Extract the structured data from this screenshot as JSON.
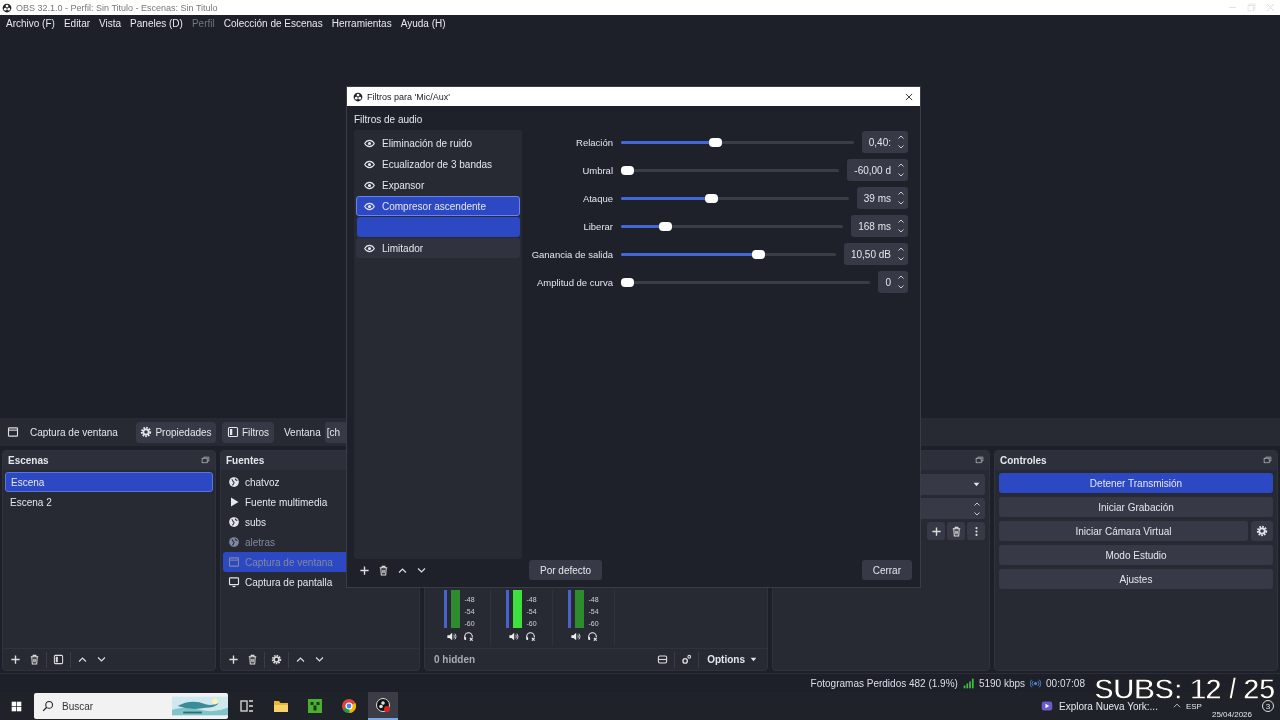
{
  "window": {
    "title": "OBS 32.1.0 - Perfil: Sin Titulo - Escenas: Sin Titulo"
  },
  "menu": [
    {
      "label": "Archivo (F)",
      "disabled": false
    },
    {
      "label": "Editar",
      "disabled": false
    },
    {
      "label": "Vista",
      "disabled": false
    },
    {
      "label": "Paneles (D)",
      "disabled": false
    },
    {
      "label": "Perfil",
      "disabled": true
    },
    {
      "label": "Colección de Escenas",
      "disabled": false
    },
    {
      "label": "Herramientas",
      "disabled": false
    },
    {
      "label": "Ayuda (H)",
      "disabled": false
    }
  ],
  "source_toolbar": {
    "source": "Captura de ventana",
    "buttons": [
      {
        "label": "Propiedades"
      },
      {
        "label": "Filtros"
      }
    ],
    "field_label": "Ventana",
    "field_value": "[ch"
  },
  "scenes": {
    "title": "Escenas",
    "items": [
      {
        "label": "Escena",
        "selected": true
      },
      {
        "label": "Escena 2",
        "selected": false
      }
    ]
  },
  "sources": {
    "title": "Fuentes",
    "items": [
      {
        "label": "chatvoz",
        "kind": "browser",
        "selected": false,
        "hidden": false
      },
      {
        "label": "Fuente multimedia",
        "kind": "media",
        "selected": false,
        "hidden": false
      },
      {
        "label": "subs",
        "kind": "browser",
        "selected": false,
        "hidden": false
      },
      {
        "label": "aletras",
        "kind": "browser",
        "selected": false,
        "hidden": true
      },
      {
        "label": "Captura de ventana",
        "kind": "window",
        "selected": true,
        "hidden": true
      },
      {
        "label": "Captura de pantalla",
        "kind": "display",
        "selected": false,
        "hidden": false
      }
    ]
  },
  "mixer": {
    "channels": [
      {
        "scale": [
          "-48",
          "-54",
          "-60"
        ]
      },
      {
        "scale": [
          "-48",
          "-54",
          "-60"
        ]
      },
      {
        "scale": [
          "-48",
          "-54",
          "-60"
        ]
      }
    ],
    "hidden_count": "0 hidden",
    "options": "Options"
  },
  "controls": {
    "title": "Controles",
    "buttons": [
      {
        "label": "Detener Transmisión",
        "active": true,
        "settings": false
      },
      {
        "label": "Iniciar Grabación",
        "active": false,
        "settings": false
      },
      {
        "label": "Iniciar Cámara Virtual",
        "active": false,
        "settings": true
      },
      {
        "label": "Modo Estudio",
        "active": false,
        "settings": false
      },
      {
        "label": "Ajustes",
        "active": false,
        "settings": false
      }
    ]
  },
  "status_bar": {
    "dropped_frames": "Fotogramas Perdidos 482 (1.9%)",
    "bitrate": "5190 kbps",
    "time": "00:07:08"
  },
  "filters_dialog": {
    "title": "Filtros para 'Mic/Aux'",
    "section": "Filtros de audio",
    "filters": [
      {
        "kind": "filter",
        "label": "Eliminación de ruido",
        "selected": false,
        "hovered": false
      },
      {
        "kind": "filter",
        "label": "Ecualizador de 3 bandas",
        "selected": false,
        "hovered": false
      },
      {
        "kind": "filter",
        "label": "Expansor",
        "selected": false,
        "hovered": false
      },
      {
        "kind": "filter",
        "label": "Compresor ascendente",
        "selected": true,
        "hovered": false
      },
      {
        "kind": "drag-ghost"
      },
      {
        "kind": "filter",
        "label": "Limitador",
        "selected": false,
        "hovered": true
      }
    ],
    "settings": [
      {
        "label": "Relación",
        "level": 0.4,
        "value": "0,40:"
      },
      {
        "label": "Umbral",
        "level": 0,
        "value": "-60,00 d"
      },
      {
        "label": "Ataque",
        "level": 0.39,
        "value": "39 ms"
      },
      {
        "label": "Liberar",
        "level": 0.18,
        "value": "168 ms"
      },
      {
        "label": "Ganancia de salida",
        "level": 0.65,
        "value": "10,50 dB"
      },
      {
        "label": "Amplitud de curva",
        "level": 0,
        "value": "0"
      }
    ],
    "defaults_button": "Por defecto",
    "close_button": "Cerrar"
  },
  "taskbar": {
    "search_placeholder": "Buscar",
    "apps": [
      {
        "kind": "taskview",
        "active": false
      },
      {
        "kind": "folder",
        "active": false
      },
      {
        "kind": "game",
        "active": false
      },
      {
        "kind": "browser",
        "active": false
      },
      {
        "kind": "obs",
        "active": true
      }
    ],
    "widget": "Explora Nueva York:...",
    "language": "ESP",
    "date": "25/04/2026",
    "notifications": "3"
  },
  "overlay_text": "SUBS: 12 / 25"
}
